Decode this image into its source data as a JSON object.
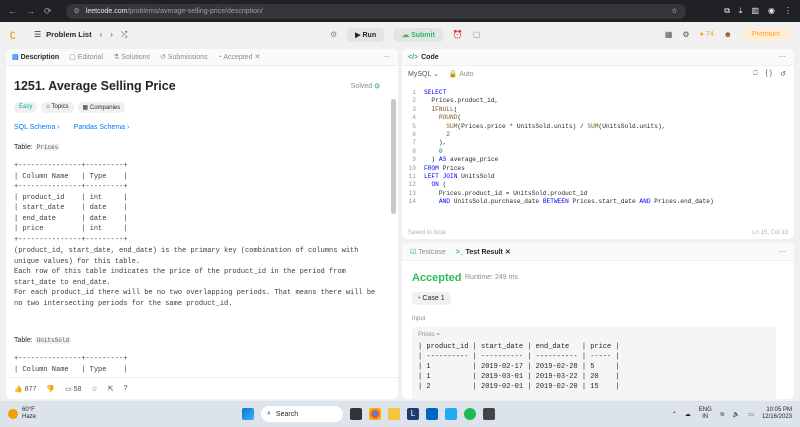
{
  "browser": {
    "url_site": "leetcode.com",
    "url_path": "/problems/average-selling-price/description/"
  },
  "topbar": {
    "problem_list": "Problem List",
    "run": "Run",
    "submit": "Submit",
    "streak": "74",
    "premium": "Premium"
  },
  "left_tabs": [
    "Description",
    "Editorial",
    "Solutions",
    "Submissions",
    "Accepted"
  ],
  "problem": {
    "title": "1251. Average Selling Price",
    "solved": "Solved",
    "badges": [
      "Easy",
      "Topics",
      "Companies"
    ],
    "schemas": [
      "SQL Schema",
      "Pandas Schema"
    ],
    "table_label": "Table:",
    "prices_name": "Prices",
    "prices_schema": "+---------------+---------+\n| Column Name   | Type    |\n+---------------+---------+\n| product_id    | int     |\n| start_date    | date    |\n| end_date      | date    |\n| price         | int     |\n+---------------+---------+",
    "prices_desc": "(product_id, start_date, end_date) is the primary key (combination of columns with unique values) for this table.\nEach row of this table indicates the price of the product_id in the period from start_date to end_date.\nFor each product_id there will be no two overlapping periods. That means there will be no two intersecting periods for the same product_id.",
    "units_name": "UnitsSold",
    "units_schema": "+---------------+---------+\n| Column Name   | Type    |"
  },
  "footer": {
    "likes": "877",
    "comments": "58"
  },
  "code": {
    "tab": "Code",
    "lang": "MySQL",
    "auto": "Auto",
    "saved": "Saved to local",
    "pos": "Ln 15, Col 13",
    "lines": [
      "SELECT",
      "  Prices.product_id,",
      "  IFNULL(",
      "    ROUND(",
      "      SUM(Prices.price * UnitsSold.units) / SUM(UnitsSold.units),",
      "      2",
      "    ),",
      "    0",
      "  ) AS average_price",
      "FROM Prices",
      "LEFT JOIN UnitsSold",
      "  ON (",
      "    Prices.product_id = UnitsSold.product_id",
      "    AND UnitsSold.purchase_date BETWEEN Prices.start_date AND Prices.end_date)"
    ]
  },
  "result": {
    "tabs": [
      "Testcase",
      "Test Result"
    ],
    "status": "Accepted",
    "runtime": "Runtime: 249 ms",
    "case": "Case 1",
    "input_label": "Input",
    "input_name": "Prices =",
    "table": "| product_id | start_date | end_date   | price |\n| ---------- | ---------- | ---------- | ----- |\n| 1          | 2019-02-17 | 2019-02-28 | 5     |\n| 1          | 2019-03-01 | 2019-03-22 | 20    |\n| 2          | 2019-02-01 | 2019-02-20 | 15    |"
  },
  "taskbar": {
    "temp": "60°F",
    "weather": "Haze",
    "search": "Search",
    "lang": "ENG",
    "region": "IN",
    "time": "10:05 PM",
    "date": "12/16/2023"
  }
}
